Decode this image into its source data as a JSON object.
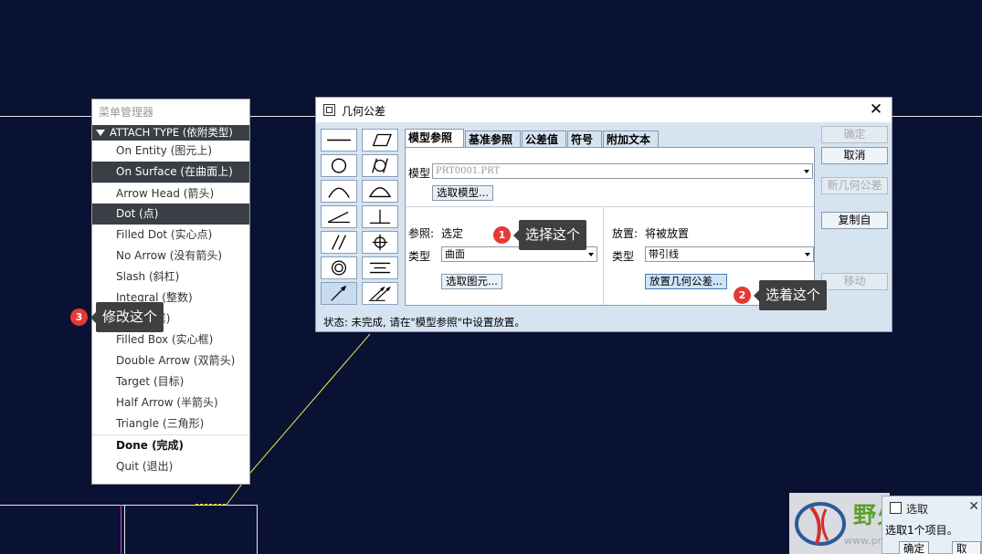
{
  "menu_manager": {
    "title": "菜单管理器",
    "header": "ATTACH TYPE (依附类型)",
    "items": [
      {
        "label": "On Entity (图元上)",
        "selected": false
      },
      {
        "label": "On Surface (在曲面上)",
        "selected": true
      },
      {
        "label": "Arrow Head (箭头)",
        "selected": false
      },
      {
        "label": "Dot (点)",
        "selected": true
      },
      {
        "label": "Filled Dot (实心点)",
        "selected": false
      },
      {
        "label": "No Arrow (没有箭头)",
        "selected": false
      },
      {
        "label": "Slash (斜杠)",
        "selected": false
      },
      {
        "label": "Integral (整数)",
        "selected": false
      },
      {
        "label": "Box (方框)",
        "selected": false
      },
      {
        "label": "Filled Box (实心框)",
        "selected": false
      },
      {
        "label": "Double Arrow (双箭头)",
        "selected": false
      },
      {
        "label": "Target (目标)",
        "selected": false
      },
      {
        "label": "Half Arrow (半箭头)",
        "selected": false
      },
      {
        "label": "Triangle (三角形)",
        "selected": false
      }
    ],
    "done": "Done (完成)",
    "quit": "Quit (退出)"
  },
  "dialog": {
    "title": "几何公差",
    "close": "✕",
    "tabs": [
      "模型参照",
      "基准参照",
      "公差值",
      "符号",
      "附加文本"
    ],
    "model_label": "模型",
    "model_value": "PRT0001.PRT",
    "select_model_btn": "选取模型...",
    "reference_label": "参照:",
    "reference_value": "选定",
    "ref_type_label": "类型",
    "ref_type_value": "曲面",
    "select_entity_btn": "选取图元...",
    "placement_label": "放置:",
    "placement_value": "将被放置",
    "place_type_label": "类型",
    "place_type_value": "带引线",
    "place_gtol_btn": "放置几何公差...",
    "side_buttons": {
      "ok": "确定",
      "cancel": "取消",
      "new": "新几何公差",
      "copy": "复制自",
      "move": "移动"
    },
    "status": "状态: 未完成, 请在\"模型参照\"中设置放置。"
  },
  "callouts": [
    {
      "badge": "1",
      "text": "选择这个"
    },
    {
      "badge": "2",
      "text": "选着这个"
    },
    {
      "badge": "3",
      "text": "修改这个"
    }
  ],
  "mini_dialog": {
    "title": "选取",
    "message": "选取1个项目。",
    "ok": "确定",
    "cancel": "取消"
  },
  "watermark": {
    "text": "野火论坛",
    "url": "www.proewildfire.cn"
  },
  "colors": {
    "canvas": "#0a1233",
    "dialog_bg": "#d6e4f2",
    "selected_menu": "#3a3f46",
    "badge": "#e53935",
    "callout": "#3f3f3f"
  }
}
